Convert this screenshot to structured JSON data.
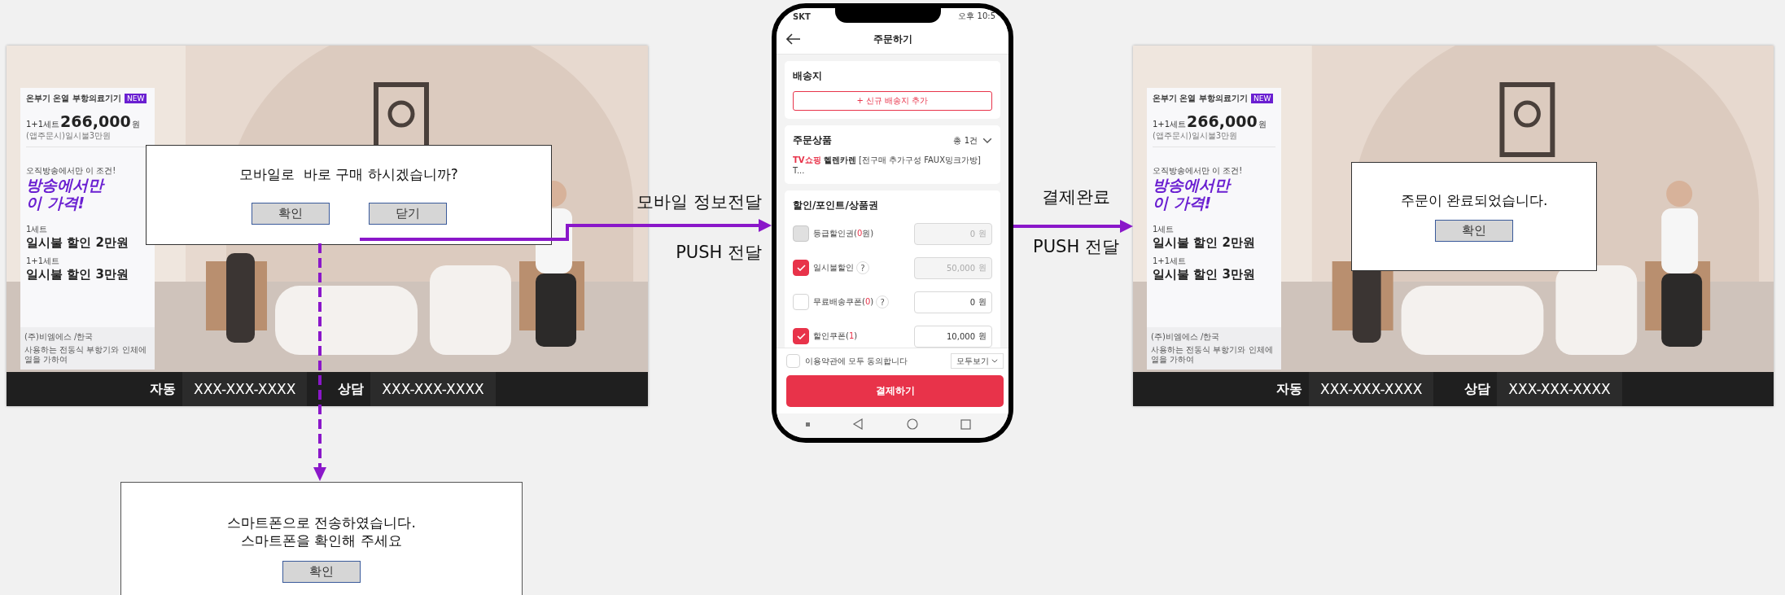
{
  "left_tv": {
    "product_panel": {
      "title": "온부기 온열 부항의료기기",
      "badge": "NEW",
      "price_prefix": "1+1세트",
      "price": "266,000",
      "price_unit": "원",
      "price_note": "(앱주문시)일시불3만원",
      "promo_intro": "오직방송에서만 이 조건!",
      "promo_lines": [
        "방송에서만",
        "이 가격!"
      ],
      "offers": [
        {
          "label": "1세트",
          "value": "일시불 할인 2만원"
        },
        {
          "label": "1+1세트",
          "value": "일시불 할인 3만원"
        }
      ],
      "footer": [
        "(주)비엠에스 /한국",
        "사용하는 전동식 부항기와 인체에 열을 가하여"
      ]
    },
    "bottom_bar": [
      {
        "label": "자동",
        "number": "XXX-XXX-XXXX"
      },
      {
        "label": "상담",
        "number": "XXX-XXX-XXXX"
      }
    ],
    "dialog": {
      "message": "모바일로  바로 구매 하시겠습니까?",
      "buttons": [
        "확인",
        "닫기"
      ]
    }
  },
  "flow_labels": [
    {
      "top": "모바일 정보전달",
      "bottom": "PUSH 전달"
    },
    {
      "top": "결제완료",
      "bottom": "PUSH 전달"
    }
  ],
  "phone": {
    "carrier": "SKT",
    "time": "오후 10:5",
    "title": "주문하기",
    "shipping": {
      "title": "배송지",
      "button": "+ 신규 배송지 추가"
    },
    "order": {
      "title": "주문상품",
      "count": "총 1건",
      "channel": "TV쇼핑",
      "brand": "헬렌카렌",
      "name": "[전구매 추가구성 FAUX밍크가방] T..."
    },
    "discount": {
      "title": "할인/포인트/상품권",
      "rows": [
        {
          "label": "등급할인권(",
          "count": "0",
          "after": "원)",
          "checked": false,
          "disabled": true,
          "amount": "0",
          "unit": "원",
          "field_disabled": true
        },
        {
          "label": "일시불할인",
          "help": "?",
          "checked": true,
          "disabled": false,
          "amount": "50,000",
          "unit": "원",
          "field_disabled": true
        },
        {
          "label": "무료배송쿠폰(",
          "count": "0",
          "after": ")",
          "help": "?",
          "checked": false,
          "disabled": false,
          "amount": "0",
          "unit": "원",
          "field_disabled": false
        },
        {
          "label": "할인쿠폰(",
          "count": "1",
          "after": ")",
          "checked": true,
          "disabled": false,
          "amount": "10,000",
          "unit": "원",
          "field_disabled": false
        }
      ]
    },
    "agree": {
      "checked": false,
      "text": "이용약관에 모두 동의합니다",
      "view_all": "모두보기"
    },
    "pay_button": "결제하기"
  },
  "right_tv": {
    "product_panel": {
      "title": "온부기 온열 부항의료기기",
      "badge": "NEW",
      "price_prefix": "1+1세트",
      "price": "266,000",
      "price_unit": "원",
      "price_note": "(앱주문시)일시불3만원",
      "promo_intro": "오직방송에서만 이 조건!",
      "promo_lines": [
        "방송에서만",
        "이 가격!"
      ],
      "offers": [
        {
          "label": "1세트",
          "value": "일시불 할인 2만원"
        },
        {
          "label": "1+1세트",
          "value": "일시불 할인 3만원"
        }
      ],
      "footer": [
        "(주)비엠에스 /한국",
        "사용하는 전동식 부항기와 인체에 열을 가하여"
      ]
    },
    "bottom_bar": [
      {
        "label": "자동",
        "number": "XXX-XXX-XXXX"
      },
      {
        "label": "상담",
        "number": "XXX-XXX-XXXX"
      }
    ],
    "dialog": {
      "message": "주문이 완료되었습니다.",
      "buttons": [
        "확인"
      ]
    }
  },
  "sent_dialog": {
    "message_lines": [
      "스마트폰으로 전송하였습니다.",
      "스마트폰을 확인해 주세요"
    ],
    "buttons": [
      "확인"
    ]
  }
}
